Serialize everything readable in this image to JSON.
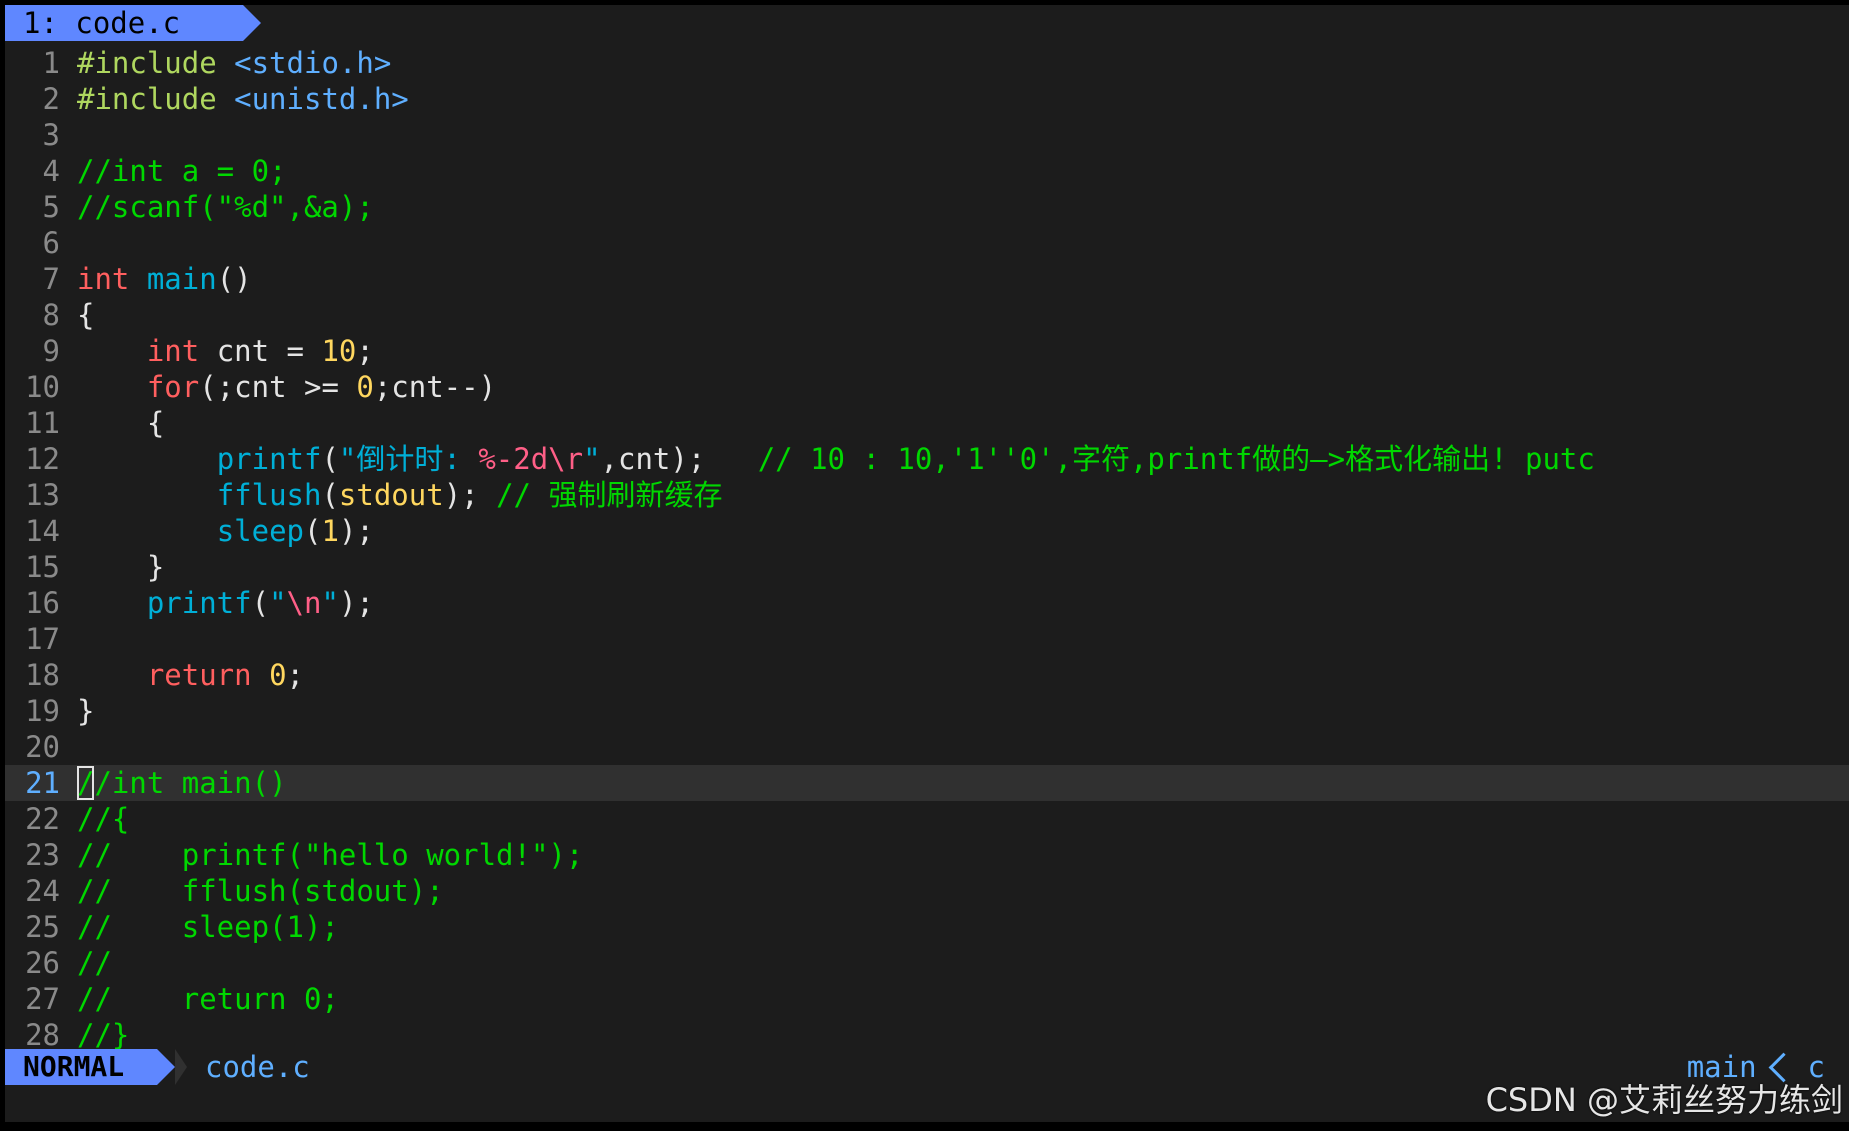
{
  "tab": {
    "label": "1: code.c"
  },
  "lines": [
    {
      "n": "1",
      "t": [
        {
          "c": "pp",
          "s": "#include "
        },
        {
          "c": "inc",
          "s": "<stdio.h>"
        }
      ]
    },
    {
      "n": "2",
      "t": [
        {
          "c": "pp",
          "s": "#include "
        },
        {
          "c": "inc",
          "s": "<unistd.h>"
        }
      ]
    },
    {
      "n": "3",
      "t": []
    },
    {
      "n": "4",
      "t": [
        {
          "c": "cm",
          "s": "//int a = 0;"
        }
      ]
    },
    {
      "n": "5",
      "t": [
        {
          "c": "cm",
          "s": "//scanf(\"%d\",&a);"
        }
      ]
    },
    {
      "n": "6",
      "t": []
    },
    {
      "n": "7",
      "t": [
        {
          "c": "kw",
          "s": "int "
        },
        {
          "c": "fn",
          "s": "main"
        },
        {
          "c": "pl",
          "s": "()"
        }
      ]
    },
    {
      "n": "8",
      "t": [
        {
          "c": "pl",
          "s": "{"
        }
      ]
    },
    {
      "n": "9",
      "t": [
        {
          "c": "pl",
          "s": "    "
        },
        {
          "c": "kw",
          "s": "int "
        },
        {
          "c": "pl",
          "s": "cnt = "
        },
        {
          "c": "num",
          "s": "10"
        },
        {
          "c": "pl",
          "s": ";"
        }
      ]
    },
    {
      "n": "10",
      "t": [
        {
          "c": "pl",
          "s": "    "
        },
        {
          "c": "kw",
          "s": "for"
        },
        {
          "c": "pl",
          "s": "(;cnt >= "
        },
        {
          "c": "num",
          "s": "0"
        },
        {
          "c": "pl",
          "s": ";cnt--)"
        }
      ]
    },
    {
      "n": "11",
      "t": [
        {
          "c": "pl",
          "s": "    {"
        }
      ]
    },
    {
      "n": "12",
      "t": [
        {
          "c": "pl",
          "s": "        "
        },
        {
          "c": "fn",
          "s": "printf"
        },
        {
          "c": "pl",
          "s": "("
        },
        {
          "c": "str",
          "s": "\"倒计时: "
        },
        {
          "c": "esc",
          "s": "%-2d\\r"
        },
        {
          "c": "str",
          "s": "\""
        },
        {
          "c": "pl",
          "s": ",cnt);   "
        },
        {
          "c": "cm",
          "s": "// 10 : 10,'1''0',字符,printf做的—>格式化输出! putc"
        }
      ]
    },
    {
      "n": "13",
      "t": [
        {
          "c": "pl",
          "s": "        "
        },
        {
          "c": "fn",
          "s": "fflush"
        },
        {
          "c": "pl",
          "s": "("
        },
        {
          "c": "num",
          "s": "stdout"
        },
        {
          "c": "pl",
          "s": "); "
        },
        {
          "c": "cm",
          "s": "// 强制刷新缓存"
        }
      ]
    },
    {
      "n": "14",
      "t": [
        {
          "c": "pl",
          "s": "        "
        },
        {
          "c": "fn",
          "s": "sleep"
        },
        {
          "c": "pl",
          "s": "("
        },
        {
          "c": "num",
          "s": "1"
        },
        {
          "c": "pl",
          "s": ");"
        }
      ]
    },
    {
      "n": "15",
      "t": [
        {
          "c": "pl",
          "s": "    }"
        }
      ]
    },
    {
      "n": "16",
      "t": [
        {
          "c": "pl",
          "s": "    "
        },
        {
          "c": "fn",
          "s": "printf"
        },
        {
          "c": "pl",
          "s": "("
        },
        {
          "c": "str",
          "s": "\""
        },
        {
          "c": "esc",
          "s": "\\n"
        },
        {
          "c": "str",
          "s": "\""
        },
        {
          "c": "pl",
          "s": ");"
        }
      ]
    },
    {
      "n": "17",
      "t": []
    },
    {
      "n": "18",
      "t": [
        {
          "c": "pl",
          "s": "    "
        },
        {
          "c": "kw",
          "s": "return "
        },
        {
          "c": "num",
          "s": "0"
        },
        {
          "c": "pl",
          "s": ";"
        }
      ]
    },
    {
      "n": "19",
      "t": [
        {
          "c": "pl",
          "s": "}"
        }
      ]
    },
    {
      "n": "20",
      "t": []
    },
    {
      "n": "21",
      "cursor": true,
      "t": [
        {
          "c": "cur",
          "s": "/"
        },
        {
          "c": "cm",
          "s": "/int main()"
        }
      ]
    },
    {
      "n": "22",
      "t": [
        {
          "c": "cm",
          "s": "//{"
        }
      ]
    },
    {
      "n": "23",
      "t": [
        {
          "c": "cm",
          "s": "//    printf(\"hello world!\");"
        }
      ]
    },
    {
      "n": "24",
      "t": [
        {
          "c": "cm",
          "s": "//    fflush(stdout);"
        }
      ]
    },
    {
      "n": "25",
      "t": [
        {
          "c": "cm",
          "s": "//    sleep(1);"
        }
      ]
    },
    {
      "n": "26",
      "t": [
        {
          "c": "cm",
          "s": "//"
        }
      ]
    },
    {
      "n": "27",
      "t": [
        {
          "c": "cm",
          "s": "//    return 0;"
        }
      ]
    },
    {
      "n": "28",
      "t": [
        {
          "c": "cm",
          "s": "//}"
        }
      ]
    }
  ],
  "status": {
    "mode": "NORMAL",
    "file": "code.c",
    "function": "main",
    "filetype": "c"
  },
  "watermark": "CSDN @艾莉丝努力练剑"
}
